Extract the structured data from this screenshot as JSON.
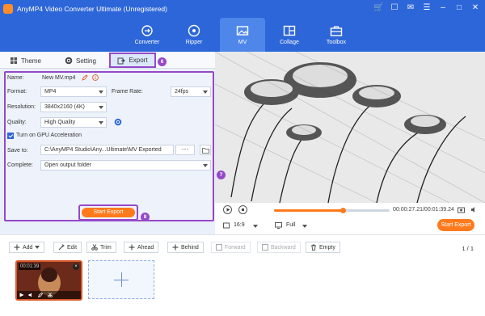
{
  "app": {
    "title": "AnyMP4 Video Converter Ultimate (Unregistered)",
    "window_controls": [
      "cart-icon",
      "gift-icon",
      "chat-icon",
      "menu-icon",
      "minimize-icon",
      "maximize-icon",
      "close-icon"
    ]
  },
  "tabs": [
    {
      "label": "Converter",
      "icon": "converter-icon",
      "active": false
    },
    {
      "label": "Ripper",
      "icon": "disc-icon",
      "active": false
    },
    {
      "label": "MV",
      "icon": "image-icon",
      "active": true
    },
    {
      "label": "Collage",
      "icon": "collage-icon",
      "active": false
    },
    {
      "label": "Toolbox",
      "icon": "toolbox-icon",
      "active": false
    }
  ],
  "subtabs": {
    "theme": "Theme",
    "setting": "Setting",
    "export": "Export"
  },
  "steps": {
    "export_tab": "6",
    "preview": "7",
    "start_export": "8"
  },
  "export_form": {
    "name_label": "Name:",
    "name_value": "New MV.mp4",
    "format_label": "Format:",
    "format_value": "MP4",
    "framerate_label": "Frame Rate:",
    "framerate_value": "24fps",
    "resolution_label": "Resolution:",
    "resolution_value": "3840x2160 (4K)",
    "quality_label": "Quality:",
    "quality_value": "High Quality",
    "gpu_label": "Turn on GPU Acceleration",
    "gpu_checked": true,
    "save_label": "Save to:",
    "save_value": "C:\\AnyMP4 Studio\\Any...Ultimate\\MV Exported",
    "browse_label": "···",
    "complete_label": "Complete:",
    "complete_value": "Open output folder"
  },
  "start_export_label": "Start Export",
  "player": {
    "time": "00:00:27.21/00:01:39.24",
    "progress": 0.6,
    "aspect": "16:9",
    "view_mode": "Full",
    "export_label": "Start Export"
  },
  "toolbar": {
    "add": "Add",
    "edit": "Edit",
    "trim": "Trim",
    "ahead": "Ahead",
    "behind": "Behind",
    "forward": "Forward",
    "backward": "Backward",
    "empty": "Empty",
    "pager": "1 / 1"
  },
  "timeline": {
    "clip_duration": "00:01:39",
    "add_clip_icon": "plus-icon"
  },
  "colors": {
    "brand_blue": "#2d66d9",
    "accent_orange": "#ff7a1c",
    "highlight_purple": "#9548c9"
  }
}
